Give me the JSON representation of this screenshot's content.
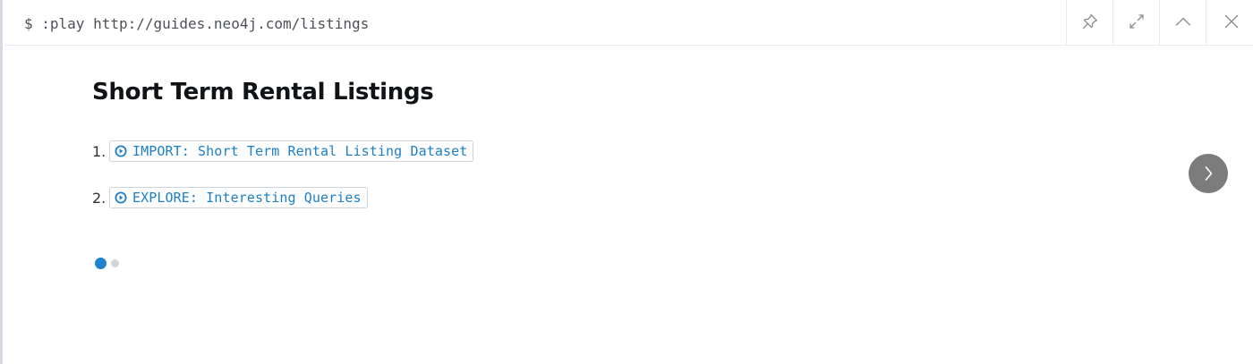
{
  "command": {
    "text": "$ :play http://guides.neo4j.com/listings"
  },
  "toolbar": {
    "buttons": [
      {
        "name": "pin-icon"
      },
      {
        "name": "expand-icon"
      },
      {
        "name": "collapse-icon"
      },
      {
        "name": "close-icon"
      }
    ]
  },
  "guide": {
    "title": "Short Term Rental Listings",
    "items": [
      {
        "number": "1.",
        "label": "IMPORT: Short Term Rental Listing Dataset"
      },
      {
        "number": "2.",
        "label": "EXPLORE: Interesting Queries"
      }
    ]
  },
  "pagination": {
    "current_slide": 1,
    "total_slides": 2
  },
  "colors": {
    "accent": "#1f84cc",
    "link": "#1d80c6",
    "next_button": "#7c7c7c"
  }
}
